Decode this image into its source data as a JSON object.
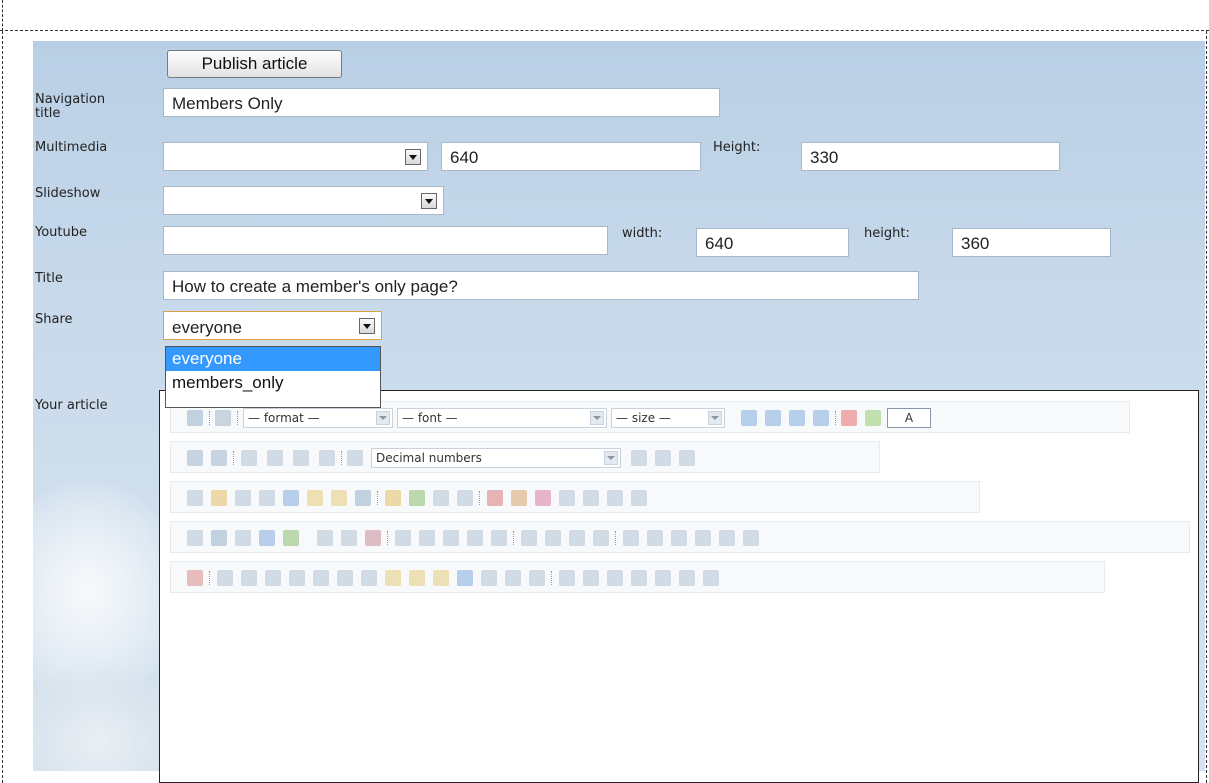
{
  "form": {
    "publish_label": "Publish article",
    "labels": {
      "navigation_title_1": "Navigation",
      "navigation_title_2": "title",
      "multimedia": "Multimedia",
      "slideshow": "Slideshow",
      "youtube": "Youtube",
      "title": "Title",
      "share": "Share",
      "your_article": "Your article"
    },
    "navigation_title_value": "Members Only",
    "multimedia": {
      "selected": "",
      "width_value": "640",
      "height_label": "Height:",
      "height_value": "330"
    },
    "slideshow": {
      "selected": ""
    },
    "youtube": {
      "value": "",
      "width_label": "width:",
      "width_value": "640",
      "height_label": "height:",
      "height_value": "360"
    },
    "title_value": "How to create a member's only page?",
    "share": {
      "selected": "everyone",
      "options": [
        "everyone",
        "members_only"
      ]
    }
  },
  "editor": {
    "format_select": "— format —",
    "font_select": "— font —",
    "size_select": "— size —",
    "a_button": "A",
    "list_select": "Decimal numbers"
  },
  "colors": {
    "panel": "#c6d8ea",
    "dropdown_selected": "#3399ff"
  }
}
